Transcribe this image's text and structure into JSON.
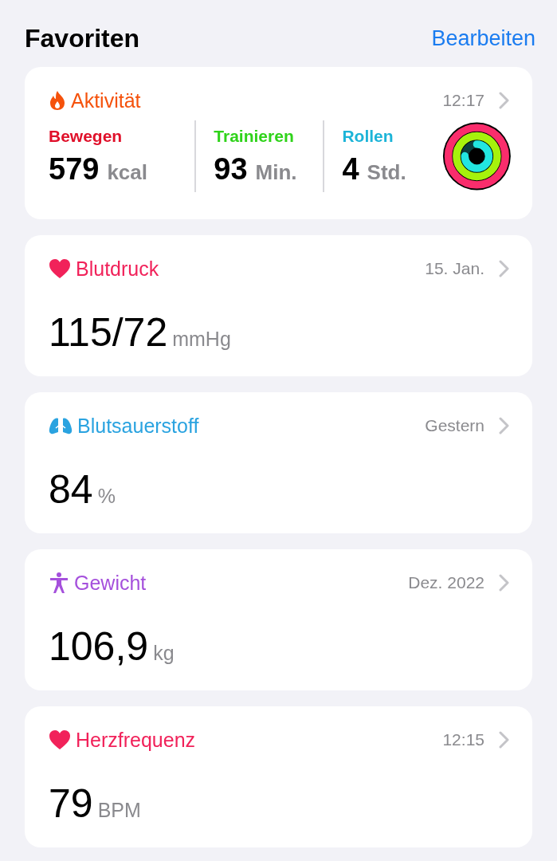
{
  "header": {
    "title": "Favoriten",
    "edit_link": "Bearbeiten"
  },
  "cards": [
    {
      "kind": "activity",
      "title": "Aktivität",
      "color": "#f5520c",
      "time": "12:17",
      "metrics": [
        {
          "label": "Bewegen",
          "color": "#e0102a",
          "value": "579",
          "unit": "kcal"
        },
        {
          "label": "Trainieren",
          "color": "#2fd31a",
          "value": "93",
          "unit": "Min."
        },
        {
          "label": "Rollen",
          "color": "#1cb4d8",
          "value": "4",
          "unit": "Std."
        }
      ]
    },
    {
      "kind": "pressure",
      "title": "Blutdruck",
      "color": "#f1225a",
      "time": "15. Jan.",
      "value": "115/72",
      "unit": "mmHg"
    },
    {
      "kind": "oxygen",
      "title": "Blutsauerstoff",
      "color": "#2aa3e0",
      "time": "Gestern",
      "value": "84",
      "unit": "%"
    },
    {
      "kind": "weight",
      "title": "Gewicht",
      "color": "#a550dc",
      "time": "Dez. 2022",
      "value": "106,9",
      "unit": "kg"
    },
    {
      "kind": "heartrate",
      "title": "Herzfrequenz",
      "color": "#f1225a",
      "time": "12:15",
      "value": "79",
      "unit": "BPM"
    }
  ]
}
